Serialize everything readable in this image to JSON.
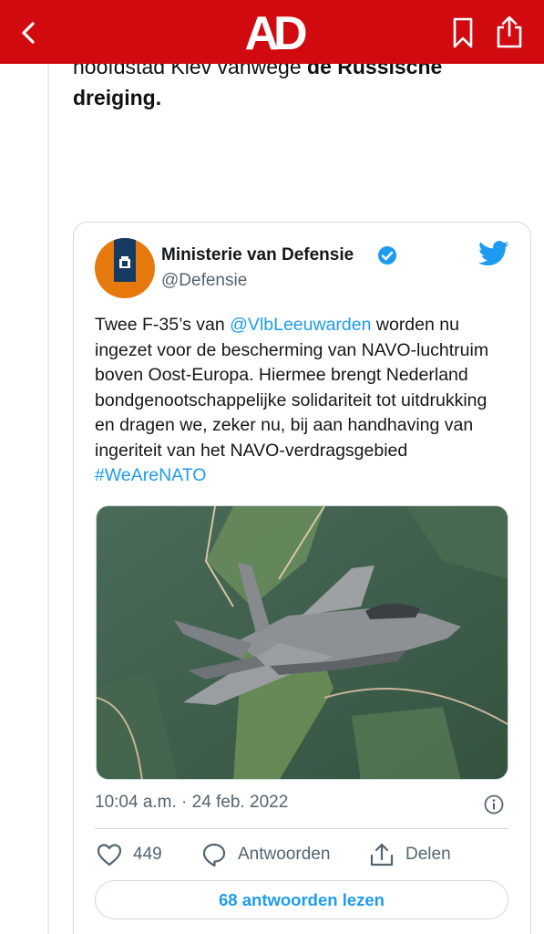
{
  "header": {
    "logo_text": "AD",
    "icons": {
      "back": "chevron-left-icon",
      "bookmark": "bookmark-icon",
      "share": "share-icon"
    },
    "color": "#d10a10"
  },
  "article": {
    "line1_regular": "hoofdstad Kiev vanwege ",
    "line1_bold": "de Russische",
    "line2_bold": "dreiging."
  },
  "tweet": {
    "author_name": "Ministerie van Defensie",
    "author_handle": "@Defensie",
    "text_part1": "Twee F-35’s van ",
    "mention": "@VlbLeeuwarden",
    "text_part2": " worden nu ingezet voor de bescherming van NAVO-luchtruim boven Oost-Europa. Hiermee brengt Nederland bondgenootschappelijke solidariteit tot uitdrukking en dragen we, zeker nu, bij aan handhaving van ingeriteit van het NAVO-verdragsgebied ",
    "hashtag": "#WeAreNATO",
    "timestamp": "10:04 a.m. · 24 feb. 2022",
    "like_count": "449",
    "reply_label": "Antwoorden",
    "share_label": "Delen",
    "read_replies_label": "68 antwoorden lezen",
    "media_description_icon": "f35-jet-photo",
    "link_color": "#1d9bf0"
  }
}
